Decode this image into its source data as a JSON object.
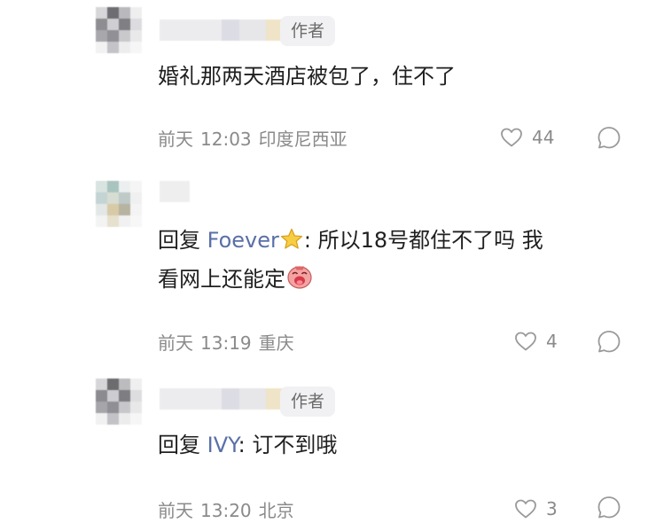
{
  "comments": [
    {
      "badge": "作者",
      "text": "婚礼那两天酒店被包了，住不了",
      "time_prefix": "前天",
      "time": "12:03",
      "location": "印度尼西亚",
      "likes": "44",
      "icons": [
        "heart-icon",
        "comment-bubble-icon"
      ]
    },
    {
      "reply_prefix": "回复",
      "reply_name": "Foever",
      "reply_name_emoji": "star-emoji",
      "text_line1": ": 所以18号都住不了吗 我",
      "text_line2": "看网上还能定",
      "text_line2_emoji": "crying-face-emoji",
      "time_prefix": "前天",
      "time": "13:19",
      "location": "重庆",
      "likes": "4",
      "icons": [
        "heart-icon",
        "comment-bubble-icon"
      ]
    },
    {
      "badge": "作者",
      "reply_prefix": "回复",
      "reply_name": "IVY",
      "text": ": 订不到哦",
      "time_prefix": "前天",
      "time": "13:20",
      "location": "北京",
      "likes": "3",
      "icons": [
        "heart-icon",
        "comment-bubble-icon"
      ]
    }
  ]
}
